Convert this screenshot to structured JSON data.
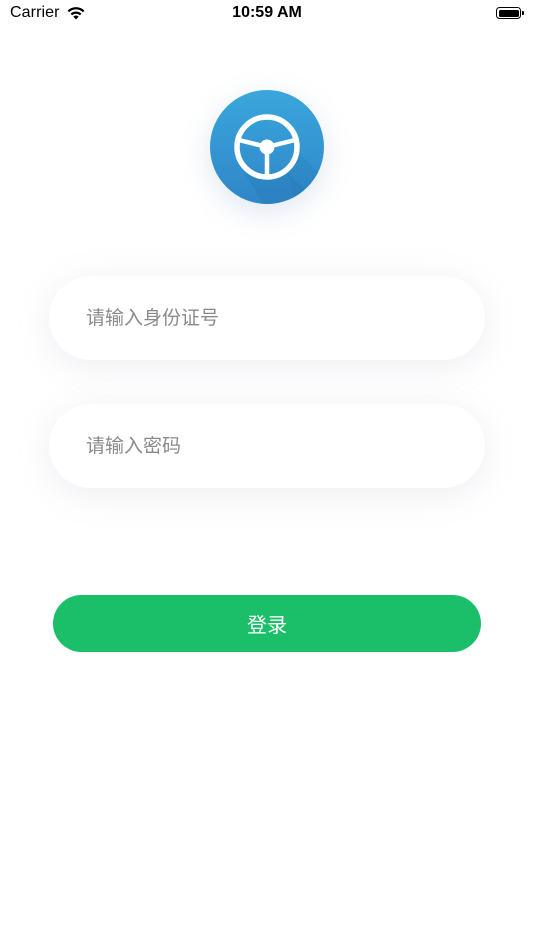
{
  "status_bar": {
    "carrier": "Carrier",
    "time": "10:59 AM",
    "wifi_icon": "wifi-icon",
    "battery_icon": "battery-full-icon"
  },
  "logo": {
    "icon": "steering-wheel-icon",
    "colors": {
      "circle_top": "#3aa6dc",
      "circle_bottom": "#2f86c8",
      "wheel": "#ffffff"
    }
  },
  "form": {
    "id_field": {
      "value": "",
      "placeholder": "请输入身份证号"
    },
    "password_field": {
      "value": "",
      "placeholder": "请输入密码"
    }
  },
  "login_button": {
    "label": "登录",
    "color": "#1bbf6a"
  }
}
